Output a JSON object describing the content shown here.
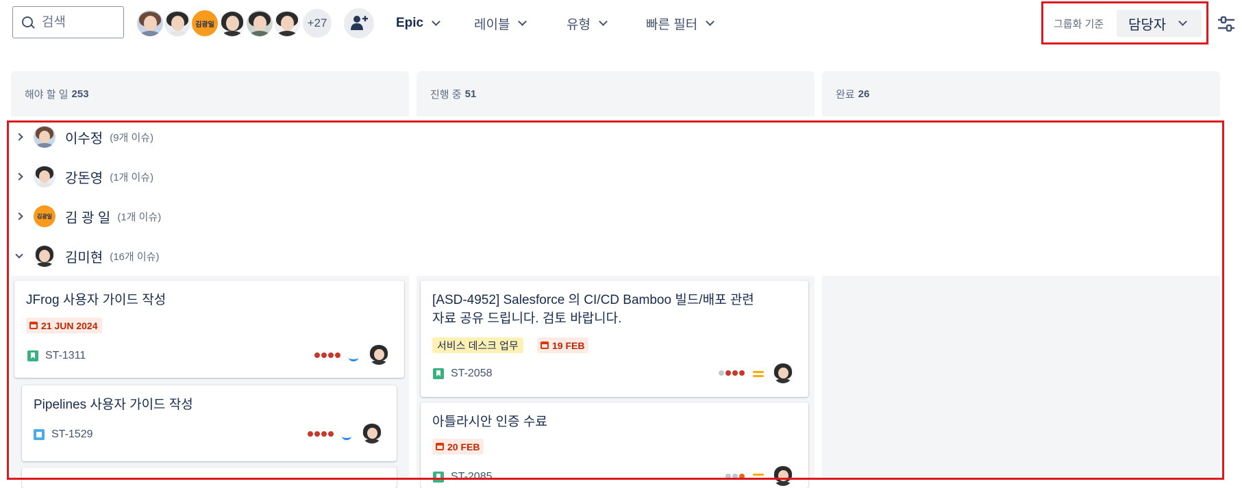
{
  "search": {
    "placeholder": "검색"
  },
  "avatars": {
    "badge_text": "김광일",
    "more_count": "+27"
  },
  "filters": {
    "epic": "Epic",
    "label": "레이블",
    "type": "유형",
    "quick": "빠른 필터"
  },
  "group_by": {
    "label": "그룹화 기준",
    "value": "담당자"
  },
  "columns": [
    {
      "name": "해야 할 일",
      "count": "253"
    },
    {
      "name": "진행 중",
      "count": "51"
    },
    {
      "name": "완료",
      "count": "26"
    }
  ],
  "swimlanes": [
    {
      "name": "이수정",
      "count": "(9개 이슈)",
      "expanded": false
    },
    {
      "name": "강돈영",
      "count": "(1개 이슈)",
      "expanded": false
    },
    {
      "name": "김 광 일",
      "count": "(1개 이슈)",
      "expanded": false,
      "badge": "김광일"
    },
    {
      "name": "김미현",
      "count": "(16개 이슈)",
      "expanded": true
    }
  ],
  "cards": {
    "todo": [
      {
        "title": "JFrog 사용자 가이드 작성",
        "date": "21 JUN 2024",
        "key": "ST-1311",
        "issue_type": "story-icon",
        "priority": "low"
      },
      {
        "title": "Pipelines 사용자 가이드 작성",
        "key": "ST-1529",
        "issue_type": "task-icon",
        "priority": "low"
      }
    ],
    "in_progress": [
      {
        "title_line1": "[ASD-4952] Salesforce 의 CI/CD Bamboo 빌드/배포 관련",
        "title_line2": "자료 공유 드립니다. 검토 바랍니다.",
        "label": "서비스 데스크 업무",
        "date": "19 FEB",
        "key": "ST-2058",
        "issue_type": "story-icon",
        "priority": "medium"
      },
      {
        "title": "아틀라시안 인증 수료",
        "date": "20 FEB",
        "key": "ST-2085",
        "issue_type": "story-icon",
        "priority": "medium"
      }
    ]
  },
  "colors": {
    "highlight": "#e0181b",
    "accent": "#0052cc",
    "column_bg": "#f4f5f7"
  }
}
